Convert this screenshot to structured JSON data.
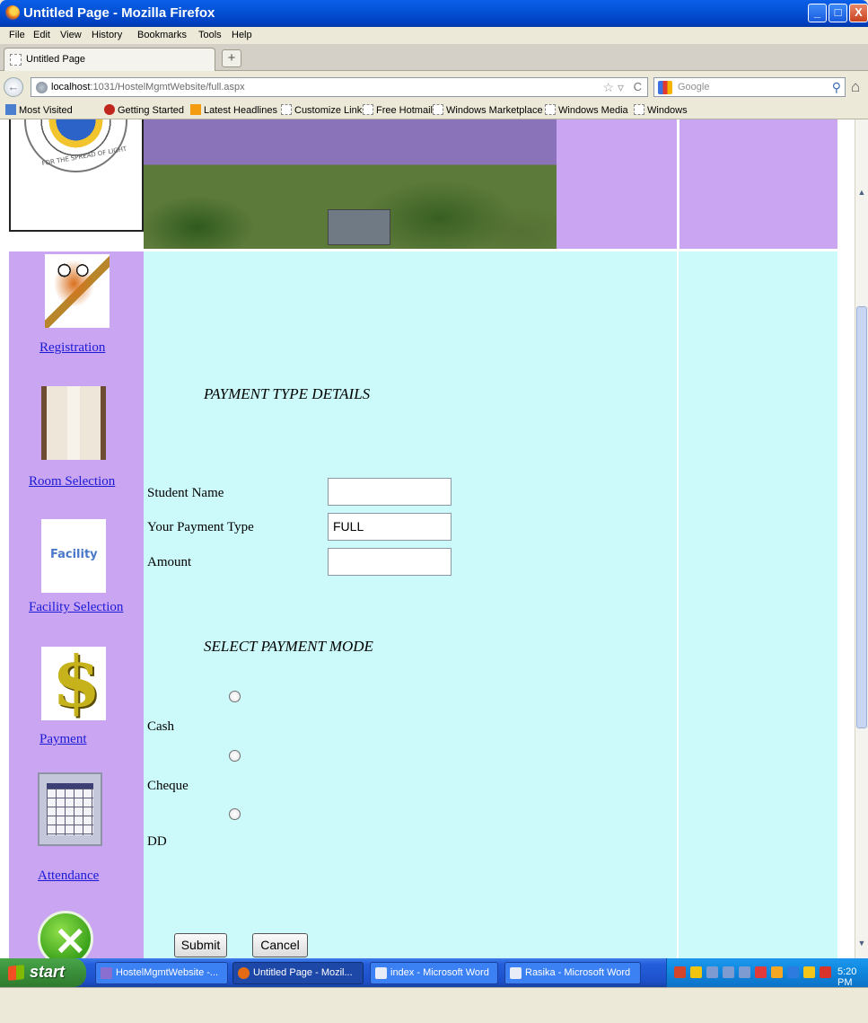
{
  "window": {
    "title": "Untitled Page - Mozilla Firefox",
    "min": "_",
    "max": "□",
    "close": "X"
  },
  "menu": [
    "File",
    "Edit",
    "View",
    "History",
    "Bookmarks",
    "Tools",
    "Help"
  ],
  "tab": {
    "label": "Untitled Page",
    "new_tab": "+"
  },
  "nav": {
    "back": "←",
    "url_host": "localhost",
    "url_rest": ":1031/HostelMgmtWebsite/full.aspx",
    "search_placeholder": "Google",
    "star": "☆ ▿",
    "reload": "C",
    "search_icon": "⚲",
    "home": "⌂"
  },
  "bookmarks": [
    "Most Visited",
    "Getting Started",
    "Latest Headlines",
    "Customize Links",
    "Free Hotmail",
    "Windows Marketplace",
    "Windows Media",
    "Windows"
  ],
  "header": {
    "logo_text": "FOR THE SPREAD OF LIGHT"
  },
  "sidebar": {
    "items": [
      {
        "label": "Registration",
        "icon": "owl-icon"
      },
      {
        "label": "Room Selection",
        "icon": "room-icon"
      },
      {
        "label": "Facility Selection",
        "icon": "facility-icon",
        "image_text": "Facility"
      },
      {
        "label": "Payment",
        "icon": "dollar-icon",
        "image_text": "$"
      },
      {
        "label": "Attendance",
        "icon": "calendar-icon"
      }
    ],
    "cancel_icon_text": "×"
  },
  "form": {
    "heading": "PAYMENT TYPE DETAILS",
    "student_name_label": "Student Name",
    "student_name_value": "",
    "payment_type_label": "Your Payment Type",
    "payment_type_value": "FULL",
    "amount_label": "Amount",
    "amount_value": "",
    "mode_heading": "SELECT PAYMENT MODE",
    "modes": [
      "Cash",
      "Cheque",
      "DD"
    ],
    "submit": "Submit",
    "cancel": "Cancel"
  },
  "taskbar": {
    "start": "start",
    "tasks": [
      "HostelMgmtWebsite -...",
      "Untitled Page - Mozil...",
      "index - Microsoft Word",
      "Rasika - Microsoft Word"
    ],
    "clock": "5:20 PM"
  },
  "colors": {
    "sidebar": "#c9a5f2",
    "content": "#ccf9f9",
    "link": "#1b1bd6",
    "taskbar": "#245edb"
  }
}
